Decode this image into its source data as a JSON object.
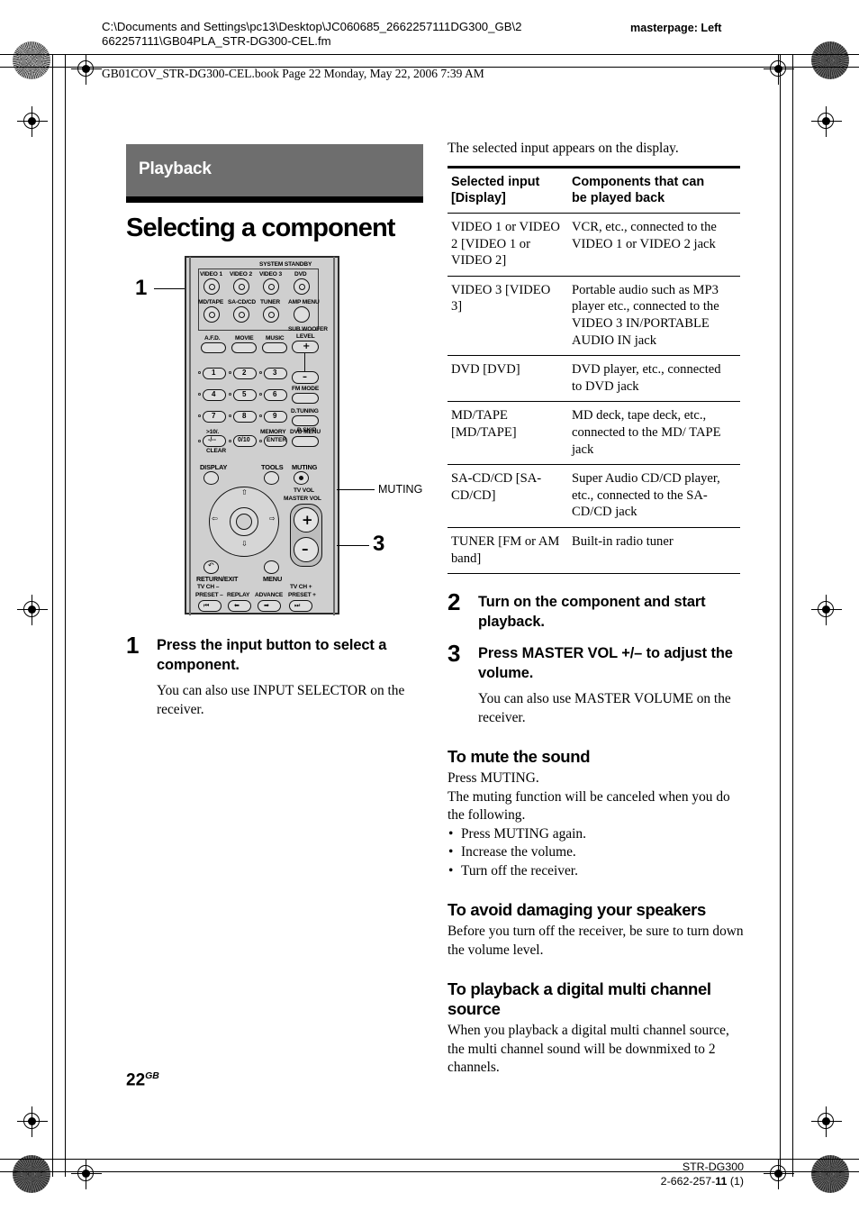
{
  "header": {
    "file_path": "C:\\Documents and Settings\\pc13\\Desktop\\JC060685_2662257111DG300_GB\\2662257111\\GB04PLA_STR-DG300-CEL.fm",
    "masterpage": "masterpage: Left",
    "book_line": "GB01COV_STR-DG300-CEL.book  Page 22  Monday, May 22, 2006  7:39 AM"
  },
  "left_column": {
    "chapter_banner": "Playback",
    "section_title": "Selecting a component",
    "step1": {
      "number": "1",
      "heading": "Press the input button to select a component.",
      "body": "You can also use INPUT SELECTOR on the receiver."
    }
  },
  "remote": {
    "system_standby_label": "SYSTEM STANDBY",
    "source_buttons_row1": [
      "VIDEO 1",
      "VIDEO 2",
      "VIDEO 3",
      "DVD"
    ],
    "source_buttons_row2": [
      "MD/TAPE",
      "SA-CD/CD",
      "TUNER"
    ],
    "amp_menu": "AMP MENU",
    "mode_buttons": [
      "A.F.D.",
      "MOVIE",
      "MUSIC"
    ],
    "sub_woofer_label": "SUB WOOFER",
    "level_label": "LEVEL",
    "sub_woofer_plus": "+",
    "sub_woofer_minus": "–",
    "numbers": [
      "1",
      "2",
      "3",
      "4",
      "5",
      "6",
      "7",
      "8",
      "9"
    ],
    "num_alt": ">10/.",
    "num_alt2": "-/--",
    "clear": "CLEAR",
    "zero_key": "0/10",
    "memory": "MEMORY",
    "enter": "ENTER",
    "fm_mode": "FM MODE",
    "d_tuning": "D.TUNING",
    "d_skip": "D.SKIP",
    "dvd_menu": "DVD MENU",
    "display": "DISPLAY",
    "tools": "TOOLS",
    "muting": "MUTING",
    "tv_vol": "TV VOL",
    "master_vol": "MASTER VOL",
    "vol_plus": "+",
    "vol_minus": "–",
    "return_exit": "RETURN/EXIT",
    "menu": "MENU",
    "tv_ch_minus": "TV CH –",
    "preset_minus": "PRESET –",
    "replay": "REPLAY",
    "advance": "ADVANCE",
    "tv_ch_plus": "TV CH +",
    "preset_plus": "PRESET +",
    "callout_1": "1",
    "callout_3": "3",
    "callout_muting": "MUTING"
  },
  "right_column": {
    "lead": "The selected input appears on the display.",
    "table": {
      "headers": [
        "Selected input [Display]",
        "Components that can be played back"
      ],
      "header_col1_line1": "Selected input",
      "header_col1_line2": "[Display]",
      "header_col2_line1": "Components that can",
      "header_col2_line2": "be played back",
      "rows": [
        {
          "input": "VIDEO 1 or VIDEO 2 [VIDEO 1 or VIDEO 2]",
          "components": "VCR, etc., connected to the VIDEO 1 or VIDEO 2 jack"
        },
        {
          "input": "VIDEO 3 [VIDEO 3]",
          "components": "Portable audio such as MP3 player etc., connected to the VIDEO 3 IN/PORTABLE AUDIO IN jack"
        },
        {
          "input": "DVD [DVD]",
          "components": "DVD player, etc., connected to DVD jack"
        },
        {
          "input": "MD/TAPE [MD/TAPE]",
          "components": "MD deck, tape deck, etc., connected to the MD/ TAPE jack"
        },
        {
          "input": "SA-CD/CD [SA-CD/CD]",
          "components": "Super Audio CD/CD player, etc., connected to the SA-CD/CD jack"
        },
        {
          "input": "TUNER [FM or AM band]",
          "components": "Built-in radio tuner"
        }
      ]
    },
    "step2": {
      "number": "2",
      "heading": "Turn on the component and start playback."
    },
    "step3": {
      "number": "3",
      "heading": "Press MASTER VOL +/– to adjust the volume.",
      "body": "You can also use MASTER VOLUME on the receiver."
    },
    "mute_section": {
      "title": "To mute the sound",
      "line1": "Press MUTING.",
      "line2": "The muting function will be canceled when you do the following.",
      "bullets": [
        "Press MUTING again.",
        "Increase the volume.",
        "Turn off the receiver."
      ]
    },
    "speakers_section": {
      "title": "To avoid damaging your speakers",
      "body": "Before you turn off the receiver, be sure to turn down the volume level."
    },
    "multichannel_section": {
      "title": "To playback a digital multi channel source",
      "body": "When you playback a digital multi channel source, the multi channel sound will be downmixed to 2 channels."
    }
  },
  "footer": {
    "page_number": "22",
    "page_suffix": "GB",
    "model": "STR-DG300",
    "part_number_prefix": "2-662-257-",
    "part_number_bold": "11",
    "part_number_suffix": " (1)"
  }
}
